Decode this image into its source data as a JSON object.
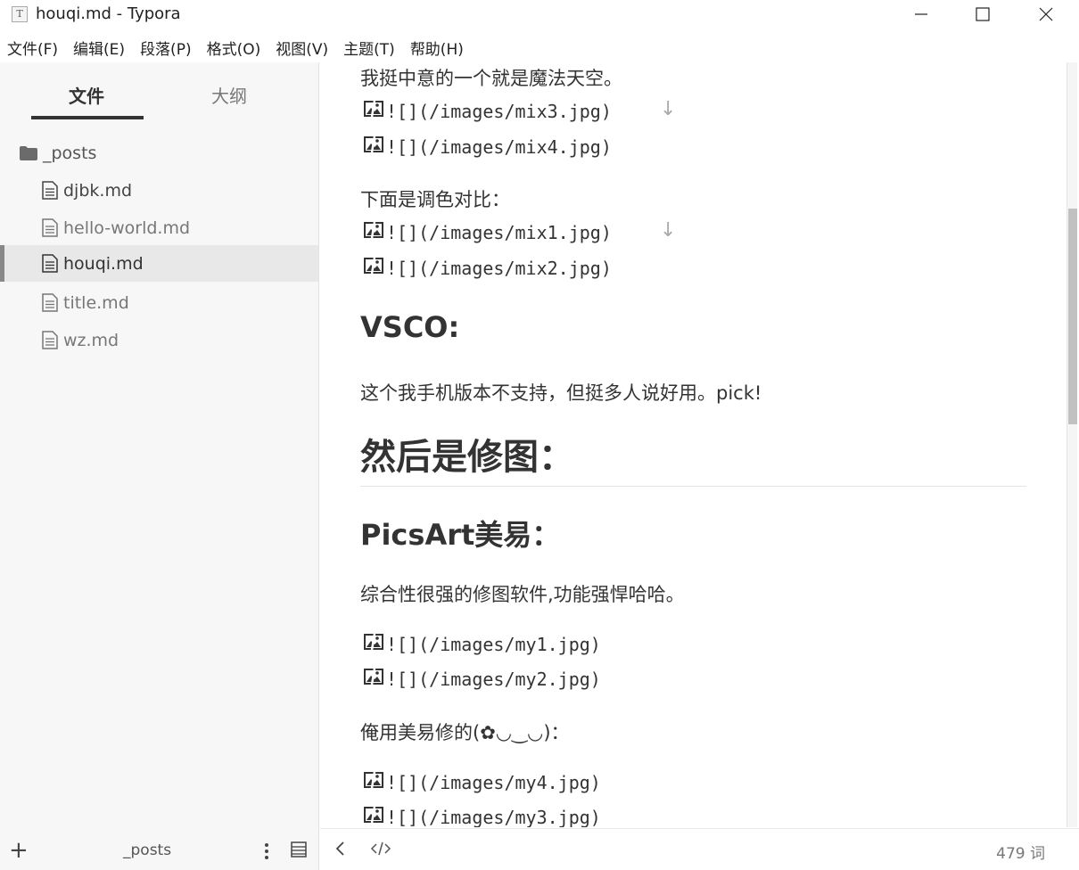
{
  "window": {
    "app_icon_glyph": "T",
    "title": "houqi.md - Typora"
  },
  "menu": [
    "文件(F)",
    "编辑(E)",
    "段落(P)",
    "格式(O)",
    "视图(V)",
    "主题(T)",
    "帮助(H)"
  ],
  "sidebar": {
    "tabs": [
      {
        "label": "文件",
        "active": true
      },
      {
        "label": "大纲",
        "active": false
      }
    ],
    "folder": {
      "name": "_posts",
      "icon": "folder-icon"
    },
    "files": [
      {
        "name": "djbk.md",
        "active": false
      },
      {
        "name": "hello-world.md",
        "active": false
      },
      {
        "name": "houqi.md",
        "active": true
      },
      {
        "name": "title.md",
        "active": false
      },
      {
        "name": "wz.md",
        "active": false
      }
    ],
    "footer": {
      "add_glyph": "+",
      "current_folder": "_posts"
    }
  },
  "editor": {
    "p1": "我挺中意的一个就是魔法天空。",
    "img_mix3": "![](/images/mix3.jpg)",
    "img_mix4": "![](/images/mix4.jpg)",
    "p2": "下面是调色对比：",
    "img_mix1": "![](/images/mix1.jpg)",
    "img_mix2": "![](/images/mix2.jpg)",
    "h_vsco": "VSCO:",
    "p3": "这个我手机版本不支持，但挺多人说好用。pick!",
    "h_retouch": "然后是修图：",
    "h_picsart": "PicsArt美易：",
    "p4": "综合性很强的修图软件,功能强悍哈哈。",
    "img_my1": "![](/images/my1.jpg)",
    "img_my2": "![](/images/my2.jpg)",
    "p5": "俺用美易修的(✿◡‿◡)：",
    "img_my4": "![](/images/my4.jpg)",
    "img_my3": "![](/images/my3.jpg)",
    "down_arrow_glyph": "↓"
  },
  "status": {
    "word_count": "479 词"
  },
  "colors": {
    "sidebar_bg": "#f7f7f7",
    "active_row_bg": "#e8e8e8",
    "text": "#333333"
  }
}
